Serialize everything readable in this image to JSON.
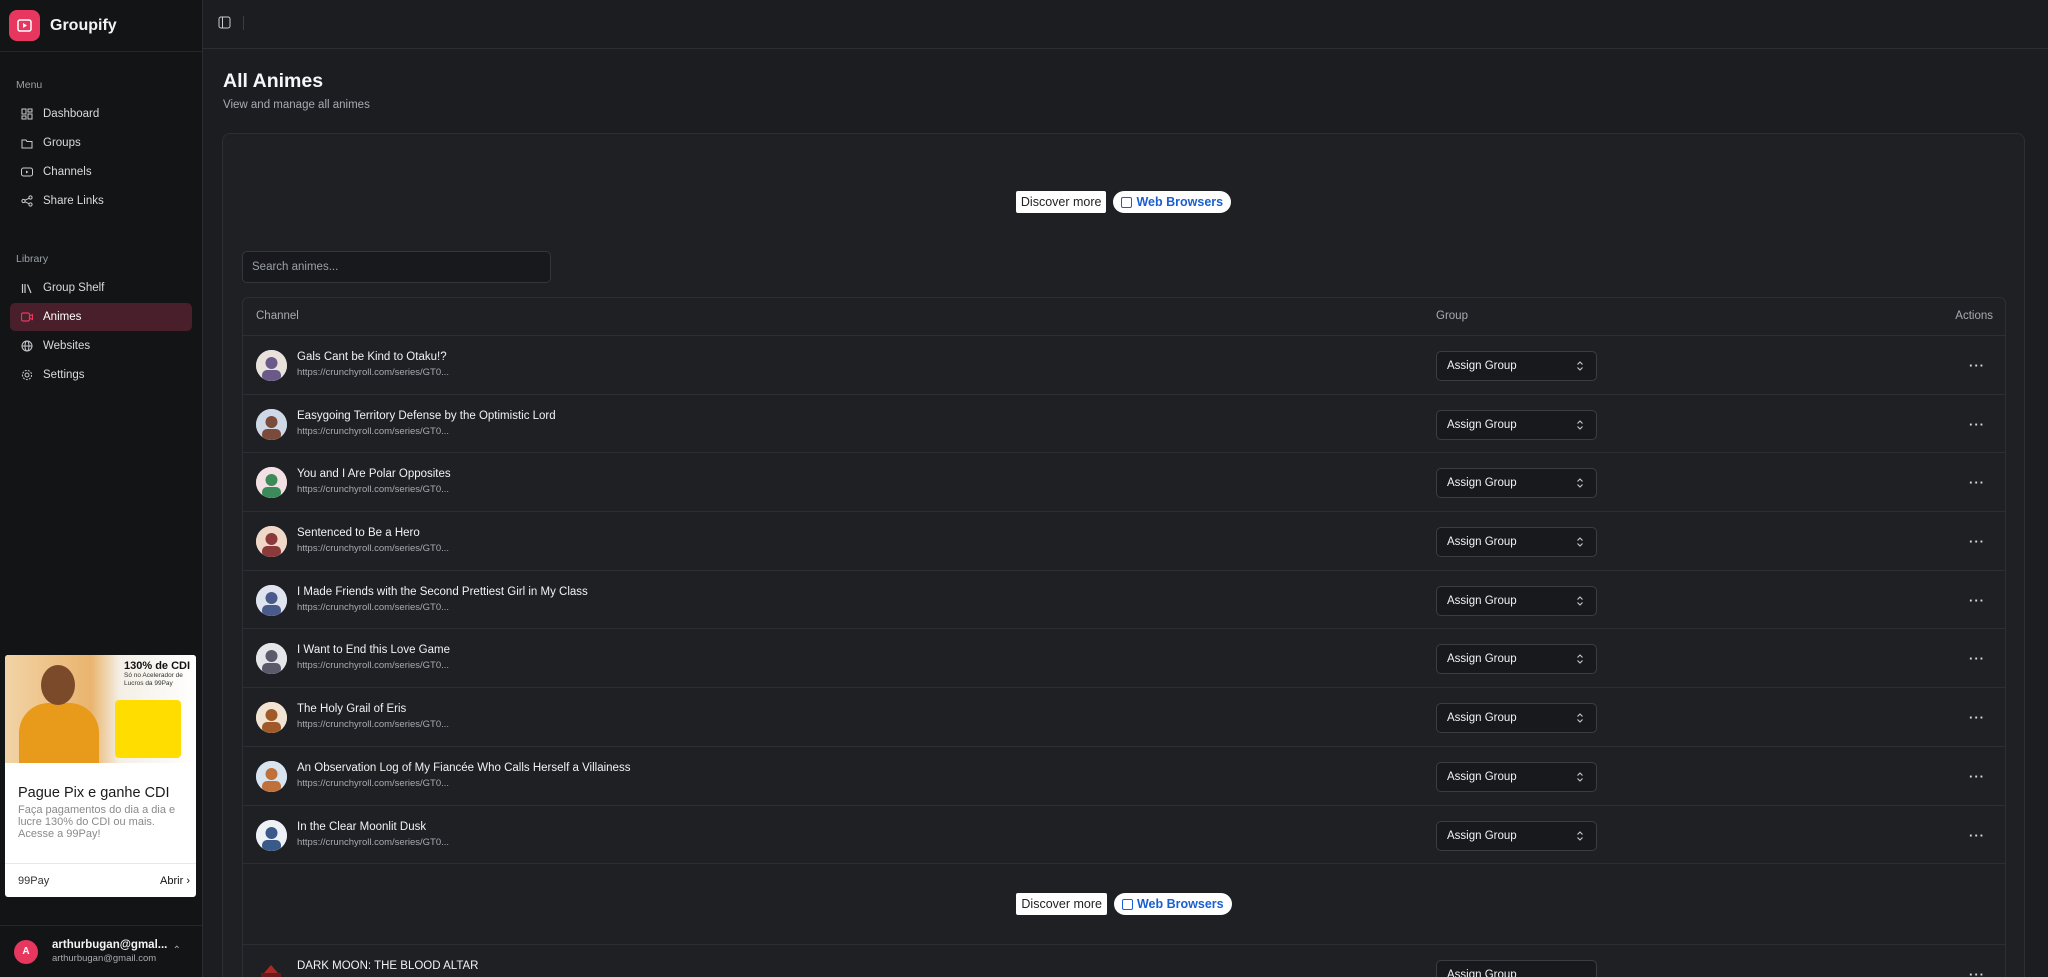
{
  "app": {
    "name": "Groupify"
  },
  "sidebar": {
    "menu_label": "Menu",
    "menu": [
      {
        "label": "Dashboard",
        "icon": "dashboard-icon"
      },
      {
        "label": "Groups",
        "icon": "folder-icon"
      },
      {
        "label": "Channels",
        "icon": "youtube-icon"
      },
      {
        "label": "Share Links",
        "icon": "share-icon"
      }
    ],
    "library_label": "Library",
    "library": [
      {
        "label": "Group Shelf",
        "icon": "library-icon"
      },
      {
        "label": "Animes",
        "icon": "tv-icon",
        "active": true
      },
      {
        "label": "Websites",
        "icon": "globe-icon"
      },
      {
        "label": "Settings",
        "icon": "gear-icon"
      }
    ]
  },
  "ad": {
    "badge_title": "130% de CDI",
    "badge_text": "Só no Acelerador de Lucros da 99Pay",
    "title": "Pague Pix e ganhe CDI",
    "text": "Faça pagamentos do dia a dia e lucre 130% do CDI ou mais. Acesse a 99Pay!",
    "brand": "99Pay",
    "cta": "Abrir"
  },
  "user": {
    "initial": "A",
    "name": "arthurbugan@gmal...",
    "email": "arthurbugan@gmail.com"
  },
  "page": {
    "title": "All Animes",
    "subtitle": "View and manage all animes"
  },
  "promo": {
    "discover": "Discover more",
    "web": "Web Browsers"
  },
  "search": {
    "placeholder": "Search animes..."
  },
  "table": {
    "headers": {
      "channel": "Channel",
      "group": "Group",
      "actions": "Actions"
    },
    "assign_label": "Assign Group",
    "rows": [
      {
        "title": "Gals Cant be Kind to Otaku!?",
        "url": "https://crunchyroll.com/series/GT0..."
      },
      {
        "title": "Easygoing Territory Defense by the Optimistic Lord",
        "url": "https://crunchyroll.com/series/GT0..."
      },
      {
        "title": "You and I Are Polar Opposites",
        "url": "https://crunchyroll.com/series/GT0..."
      },
      {
        "title": "Sentenced to Be a Hero",
        "url": "https://crunchyroll.com/series/GT0..."
      },
      {
        "title": "I Made Friends with the Second Prettiest Girl in My Class",
        "url": "https://crunchyroll.com/series/GT0..."
      },
      {
        "title": "I Want to End this Love Game",
        "url": "https://crunchyroll.com/series/GT0..."
      },
      {
        "title": "The Holy Grail of Eris",
        "url": "https://crunchyroll.com/series/GT0..."
      },
      {
        "title": "An Observation Log of My Fiancée Who Calls Herself a Villainess",
        "url": "https://crunchyroll.com/series/GT0..."
      },
      {
        "title": "In the Clear Moonlit Dusk",
        "url": "https://crunchyroll.com/series/GT0..."
      }
    ],
    "last_row": {
      "title": "DARK MOON: THE BLOOD ALTAR"
    }
  },
  "colors": {
    "accent": "#e8375f",
    "active_nav_bg": "#4a1f2c",
    "link_blue": "#1a5fd0"
  }
}
